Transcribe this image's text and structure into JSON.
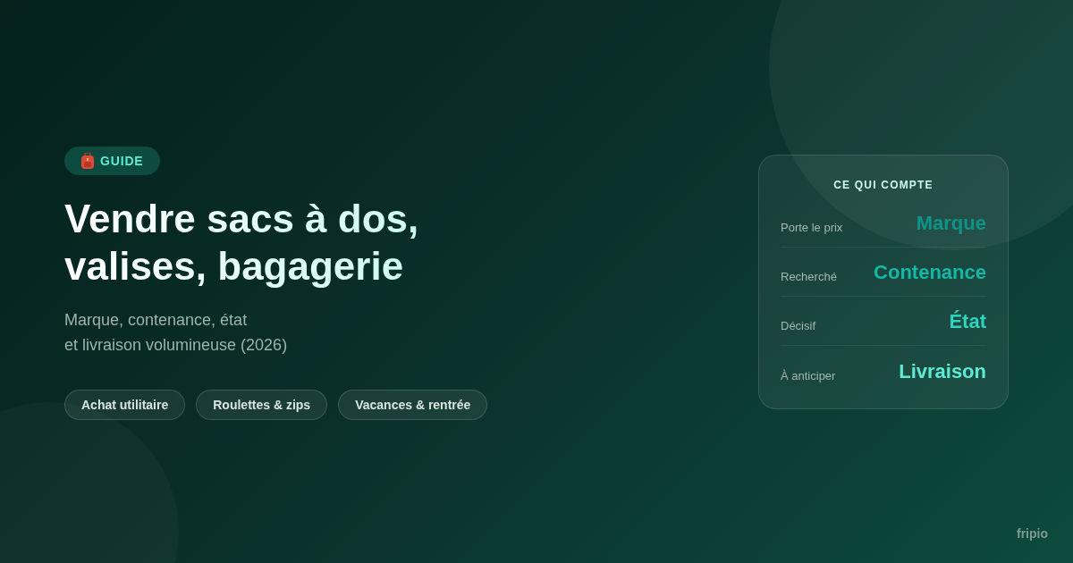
{
  "badge": {
    "label": "GUIDE"
  },
  "title": "Vendre sacs à dos,\nvalises, bagagerie",
  "subtitle": "Marque, contenance, état\net livraison volumineuse (2026)",
  "tags": [
    "Achat utilitaire",
    "Roulettes & zips",
    "Vacances & rentrée"
  ],
  "card": {
    "heading": "CE QUI COMPTE",
    "rows": [
      {
        "label": "Porte le prix",
        "value": "Marque",
        "color": "#0d9488"
      },
      {
        "label": "Recherché",
        "value": "Contenance",
        "color": "#14b8a6"
      },
      {
        "label": "Décisif",
        "value": "État",
        "color": "#2dd4bf"
      },
      {
        "label": "À anticiper",
        "value": "Livraison",
        "color": "#5eead4"
      }
    ]
  },
  "brand": "fripio"
}
